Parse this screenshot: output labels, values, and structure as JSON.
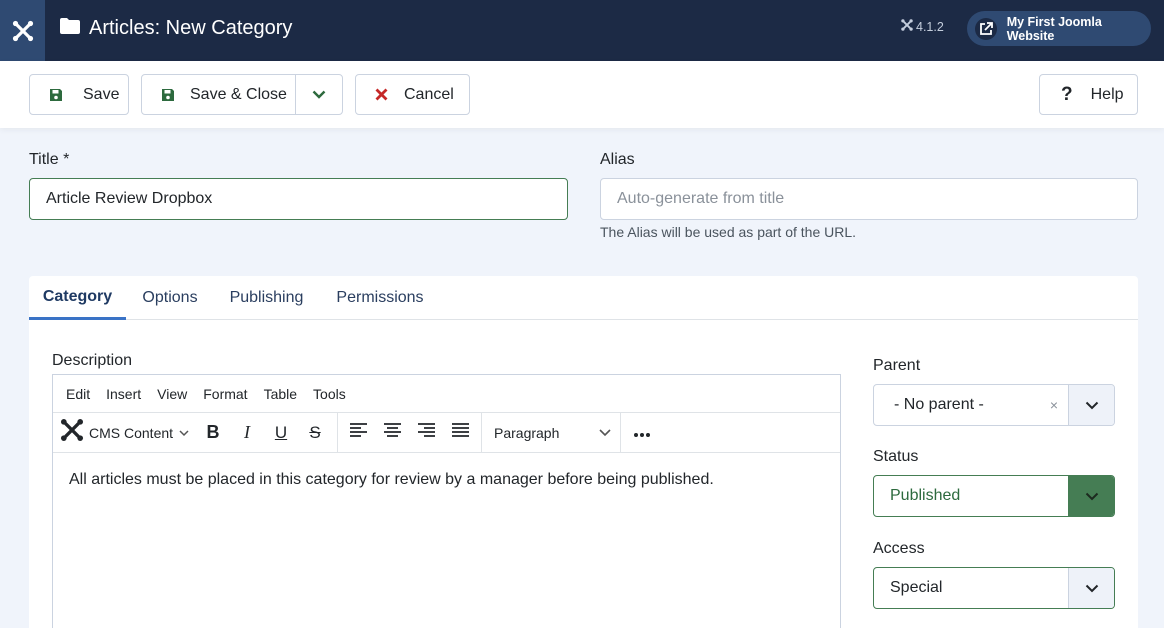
{
  "header": {
    "title": "Articles: New Category",
    "version": "4.1.2",
    "site_link": "My First Joomla Website"
  },
  "toolbar": {
    "save": "Save",
    "save_close": "Save & Close",
    "cancel": "Cancel",
    "help": "Help"
  },
  "form": {
    "title_label": "Title *",
    "title_value": "Article Review Dropbox",
    "alias_label": "Alias",
    "alias_placeholder": "Auto-generate from title",
    "alias_hint": "The Alias will be used as part of the URL."
  },
  "tabs": [
    {
      "label": "Category",
      "active": true
    },
    {
      "label": "Options",
      "active": false
    },
    {
      "label": "Publishing",
      "active": false
    },
    {
      "label": "Permissions",
      "active": false
    }
  ],
  "editor": {
    "label": "Description",
    "menu": [
      "Edit",
      "Insert",
      "View",
      "Format",
      "Table",
      "Tools"
    ],
    "cms_content": "CMS Content",
    "block_format": "Paragraph",
    "content": "All articles must be placed in this category for review by a manager before being published."
  },
  "sidebar": {
    "parent_label": "Parent",
    "parent_value": "- No parent -",
    "status_label": "Status",
    "status_value": "Published",
    "access_label": "Access",
    "access_value": "Special"
  },
  "colors": {
    "header_bg": "#1c2a45",
    "accent_green": "#457d54",
    "cancel_red": "#c52827",
    "tab_active": "#3a73c6"
  }
}
